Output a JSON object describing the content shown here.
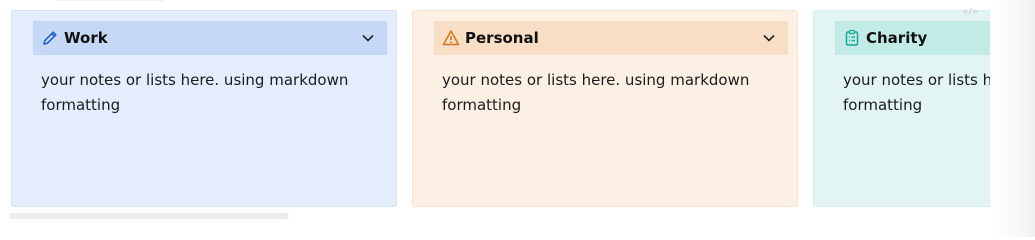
{
  "cards": [
    {
      "title": "Work",
      "icon": "pencil-icon",
      "body": "your notes or lists here. using markdown formatting",
      "accent": "#1f5fbf"
    },
    {
      "title": "Personal",
      "icon": "warning-icon",
      "body": "your notes or lists here. using markdown formatting",
      "accent": "#d4751a"
    },
    {
      "title": "Charity",
      "icon": "clipboard-icon",
      "body": "your notes or lists here. using markdown formatting",
      "accent": "#1aa89a"
    }
  ],
  "code_hint": "</>"
}
